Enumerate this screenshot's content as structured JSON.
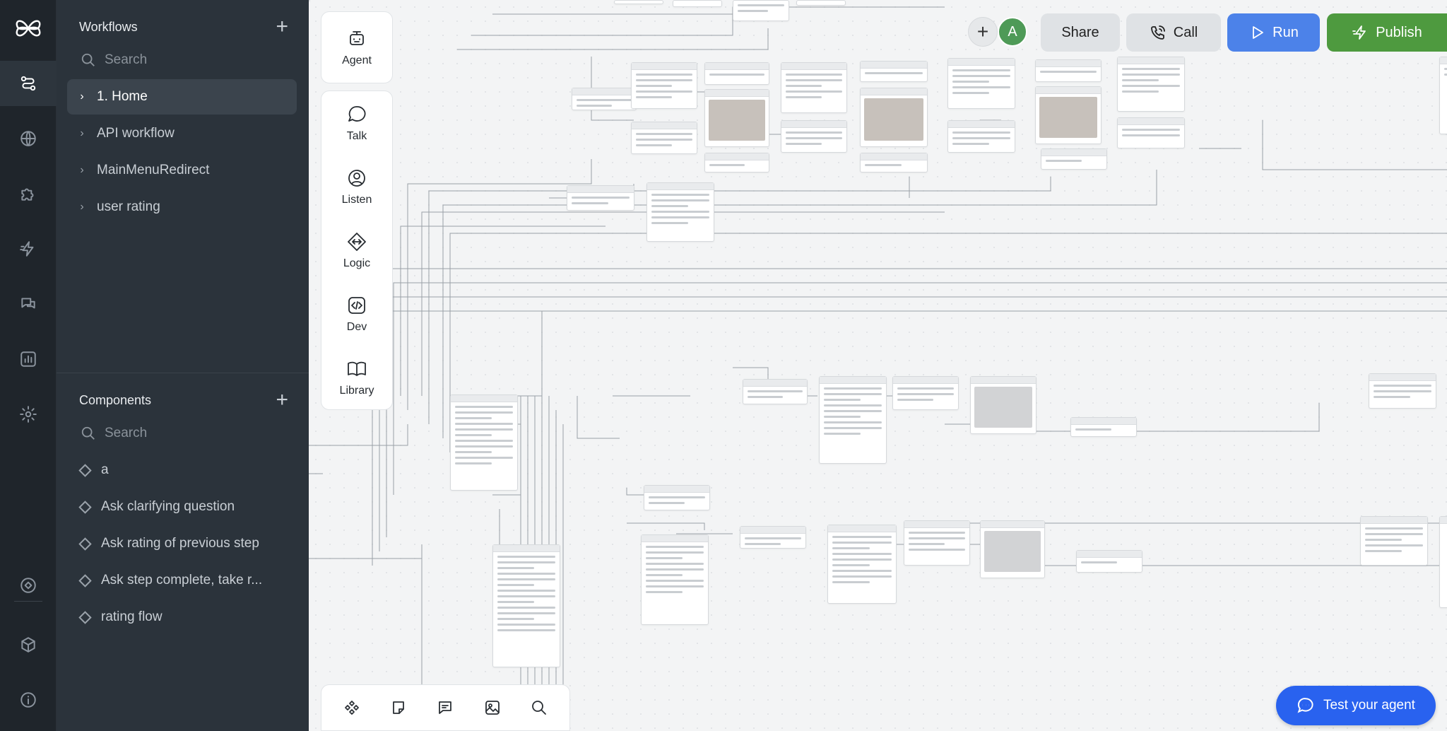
{
  "sidebar": {
    "workflows": {
      "title": "Workflows",
      "search_placeholder": "Search",
      "items": [
        {
          "label": "1. Home",
          "active": true
        },
        {
          "label": "API workflow"
        },
        {
          "label": "MainMenuRedirect"
        },
        {
          "label": "user rating"
        }
      ]
    },
    "components": {
      "title": "Components",
      "search_placeholder": "Search",
      "items": [
        {
          "label": "a"
        },
        {
          "label": "Ask clarifying question"
        },
        {
          "label": "Ask rating of previous step"
        },
        {
          "label": "Ask step complete, take r..."
        },
        {
          "label": "rating flow"
        }
      ]
    }
  },
  "palette": {
    "agent": "Agent",
    "talk": "Talk",
    "listen": "Listen",
    "logic": "Logic",
    "dev": "Dev",
    "library": "Library"
  },
  "header": {
    "avatar_initial": "A",
    "share": "Share",
    "call": "Call",
    "run": "Run",
    "publish": "Publish"
  },
  "test_agent": "Test your agent",
  "colors": {
    "rail_bg": "#1f252b",
    "sidebar_bg": "#2b333b",
    "run": "#4c82e9",
    "publish": "#4e9a3f",
    "test_agent": "#2962ef",
    "avatar": "#4e9a57"
  }
}
